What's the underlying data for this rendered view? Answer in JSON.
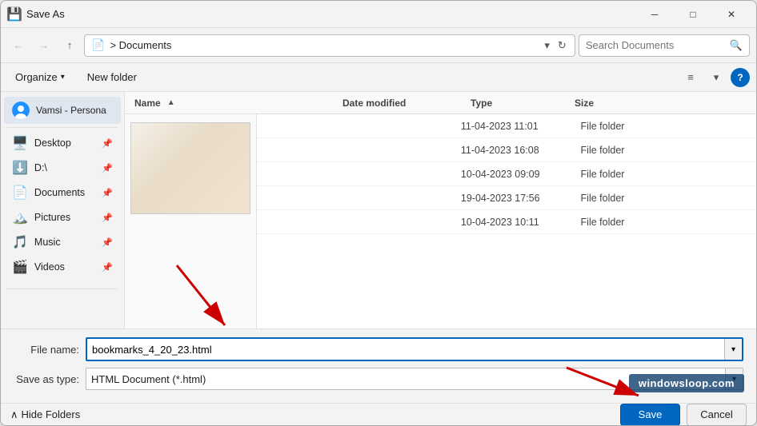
{
  "titleBar": {
    "icon": "💾",
    "title": "Save As"
  },
  "navBar": {
    "backBtn": "←",
    "forwardBtn": "→",
    "upBtn": "↑",
    "addressIcon": "📄",
    "addressPath": "Documents",
    "addressBreadcrumb": "> Documents",
    "refreshBtn": "↻",
    "searchPlaceholder": "Search Documents"
  },
  "toolbar": {
    "organizeLabel": "Organize",
    "newFolderLabel": "New folder",
    "viewIcon": "≡",
    "chevronIcon": "▾",
    "helpLabel": "?"
  },
  "sidebar": {
    "accountLabel": "Vamsi - Persona",
    "divider": true,
    "items": [
      {
        "id": "desktop",
        "icon": "🖥️",
        "label": "Desktop",
        "pinned": true
      },
      {
        "id": "downloads",
        "icon": "⬇️",
        "label": "D:\\",
        "pinned": true
      },
      {
        "id": "documents",
        "icon": "📄",
        "label": "Documents",
        "pinned": true
      },
      {
        "id": "pictures",
        "icon": "🏔️",
        "label": "Pictures",
        "pinned": true
      },
      {
        "id": "music",
        "icon": "🎵",
        "label": "Music",
        "pinned": true
      },
      {
        "id": "videos",
        "icon": "🎬",
        "label": "Videos",
        "pinned": true
      }
    ]
  },
  "fileList": {
    "columns": {
      "name": "Name",
      "dateModified": "Date modified",
      "type": "Type",
      "size": "Size"
    },
    "rows": [
      {
        "date": "11-04-2023 11:01",
        "type": "File folder",
        "size": ""
      },
      {
        "date": "11-04-2023 16:08",
        "type": "File folder",
        "size": ""
      },
      {
        "date": "10-04-2023 09:09",
        "type": "File folder",
        "size": ""
      },
      {
        "date": "19-04-2023 17:56",
        "type": "File folder",
        "size": ""
      },
      {
        "date": "10-04-2023 10:11",
        "type": "File folder",
        "size": ""
      }
    ]
  },
  "bottomBar": {
    "fileNameLabel": "File name:",
    "fileNameValue": "bookmarks_4_20_23.html",
    "saveAsTypeLabel": "Save as type:",
    "saveAsTypeValue": "HTML Document (*.html)",
    "saveBtn": "Save",
    "cancelBtn": "Cancel"
  },
  "footer": {
    "hideFoldersLabel": "Hide Folders",
    "chevron": "∧"
  },
  "watermark": {
    "text": "windowsloop.com"
  }
}
